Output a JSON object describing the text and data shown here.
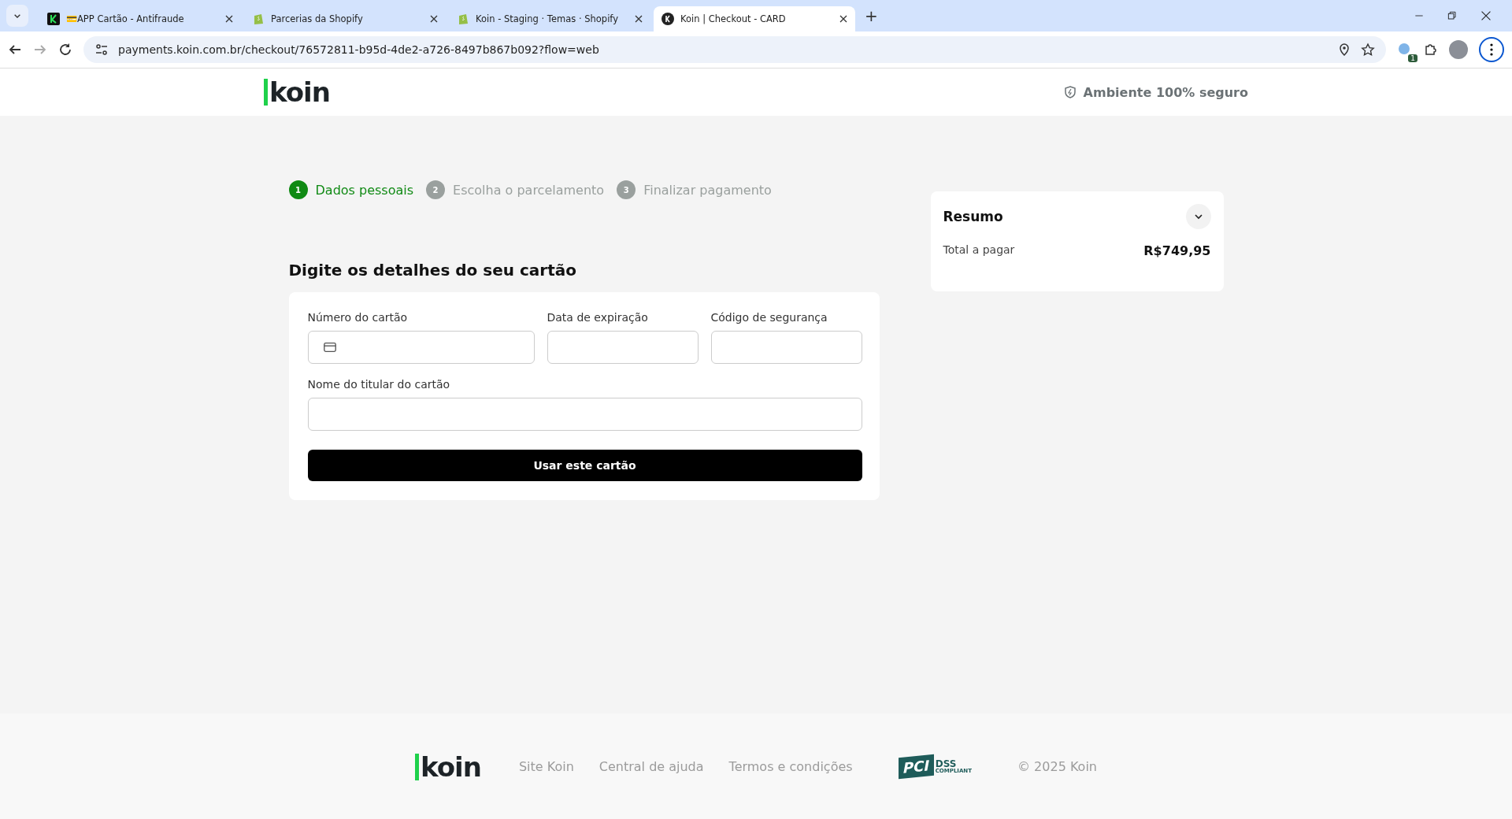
{
  "browser": {
    "tabs": [
      {
        "title": "💳APP Cartão - Antifraude",
        "selected": false,
        "kind": "k-dark"
      },
      {
        "title": "Parcerias da Shopify",
        "selected": false,
        "kind": "bag"
      },
      {
        "title": "Koin - Staging · Temas · Shopify",
        "selected": false,
        "kind": "bag"
      },
      {
        "title": "Koin | Checkout - CARD",
        "selected": true,
        "kind": "k-round"
      }
    ],
    "new_tab": "+",
    "url": "payments.koin.com.br/checkout/76572811-b95d-4de2-a726-8497b867b092?flow=web",
    "extension_badge": "1"
  },
  "header": {
    "logo": "koin",
    "security_note": "Ambiente 100% seguro"
  },
  "steps": [
    {
      "number": "1",
      "label": "Dados pessoais",
      "selected": true
    },
    {
      "number": "2",
      "label": "Escolha o parcelamento",
      "selected": false
    },
    {
      "number": "3",
      "label": "Finalizar pagamento",
      "selected": false
    }
  ],
  "form": {
    "title": "Digite os detalhes do seu cartão",
    "fields": [
      {
        "label": "Número do cartão",
        "kind": "card"
      },
      {
        "label": "Data de expiração",
        "kind": "text"
      },
      {
        "label": "Código de segurança",
        "kind": "text"
      },
      {
        "label": "Nome do titular do cartão",
        "kind": "wide"
      }
    ],
    "submit": "Usar este cartão"
  },
  "summary": {
    "title": "Resumo",
    "expanded": false,
    "total_label": "Total a pagar",
    "total_value": "R$749,95"
  },
  "footer": {
    "logo": "koin",
    "links": [
      "Site Koin",
      "Central de ajuda",
      "Termos e condições"
    ],
    "pci": {
      "main": "PCI",
      "dss": "DSS",
      "compliant": "COMPLIANT"
    },
    "copyright": "© 2025 Koin"
  }
}
